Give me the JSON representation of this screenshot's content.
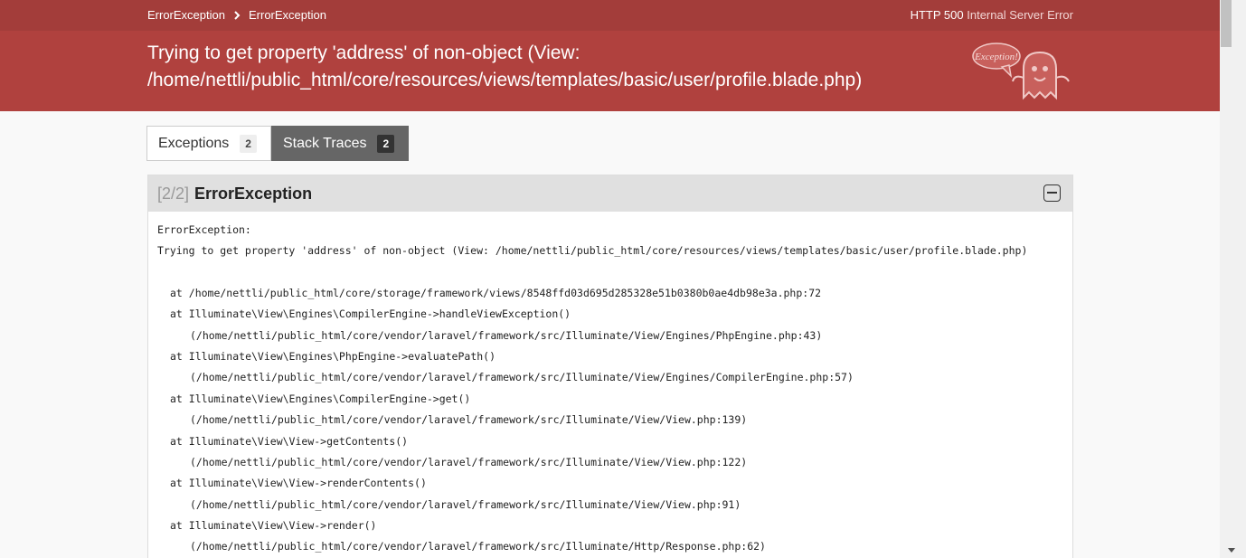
{
  "breadcrumb": [
    "ErrorException",
    "ErrorException"
  ],
  "http_status": {
    "code": "HTTP 500",
    "text": "Internal Server Error"
  },
  "title": "Trying to get property 'address' of non-object (View: /home/nettli/public_html/core/resources/views/templates/basic/user/profile.blade.php)",
  "tabs": [
    {
      "label": "Exceptions",
      "count": "2",
      "active": false
    },
    {
      "label": "Stack Traces",
      "count": "2",
      "active": true
    }
  ],
  "exception": {
    "counter": "[2/2]",
    "class": "ErrorException",
    "trace": {
      "header": "ErrorException:",
      "message": "Trying to get property 'address' of non-object (View: /home/nettli/public_html/core/resources/views/templates/basic/user/profile.blade.php)",
      "first_at": "at /home/nettli/public_html/core/storage/framework/views/8548ffd03d695d285328e51b0380b0ae4db98e3a.php:72",
      "frames": [
        {
          "call": "at Illuminate\\View\\Engines\\CompilerEngine->handleViewException()",
          "location": "(/home/nettli/public_html/core/vendor/laravel/framework/src/Illuminate/View/Engines/PhpEngine.php:43)"
        },
        {
          "call": "at Illuminate\\View\\Engines\\PhpEngine->evaluatePath()",
          "location": "(/home/nettli/public_html/core/vendor/laravel/framework/src/Illuminate/View/Engines/CompilerEngine.php:57)"
        },
        {
          "call": "at Illuminate\\View\\Engines\\CompilerEngine->get()",
          "location": "(/home/nettli/public_html/core/vendor/laravel/framework/src/Illuminate/View/View.php:139)"
        },
        {
          "call": "at Illuminate\\View\\View->getContents()",
          "location": "(/home/nettli/public_html/core/vendor/laravel/framework/src/Illuminate/View/View.php:122)"
        },
        {
          "call": "at Illuminate\\View\\View->renderContents()",
          "location": "(/home/nettli/public_html/core/vendor/laravel/framework/src/Illuminate/View/View.php:91)"
        },
        {
          "call": "at Illuminate\\View\\View->render()",
          "location": "(/home/nettli/public_html/core/vendor/laravel/framework/src/Illuminate/Http/Response.php:62)"
        }
      ]
    }
  },
  "logo": {
    "text": "Exception!"
  },
  "icons": {
    "breadcrumb_separator": "chevron-right-icon",
    "collapse": "minus-square-icon",
    "logo": "exception-ghost-icon"
  },
  "colors": {
    "header": "#b0413e",
    "topbar": "#a33d3a",
    "active_tab": "#666666"
  }
}
